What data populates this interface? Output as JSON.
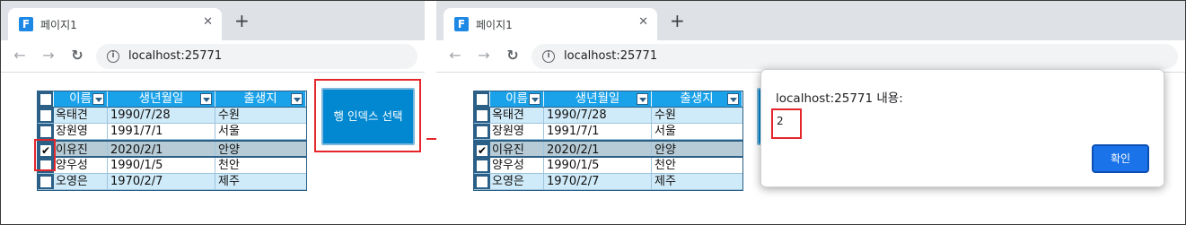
{
  "browser": {
    "tab_title": "페이지1",
    "favicon_letter": "F",
    "tab_close": "✕",
    "new_tab": "+",
    "url": "localhost:25771"
  },
  "grid": {
    "columns": [
      "이름",
      "생년월일",
      "출생지"
    ],
    "rows": [
      {
        "name": "옥태견",
        "birth": "1990/7/28",
        "place": "수원",
        "checked": false
      },
      {
        "name": "장원영",
        "birth": "1991/7/1",
        "place": "서울",
        "checked": false
      },
      {
        "name": "이유진",
        "birth": "2020/2/1",
        "place": "안양",
        "checked": true
      },
      {
        "name": "양우성",
        "birth": "1990/1/5",
        "place": "천안",
        "checked": false
      },
      {
        "name": "오영은",
        "birth": "1970/2/7",
        "place": "제주",
        "checked": false
      }
    ],
    "selected_row_index": 2
  },
  "action_button": {
    "label": "행 인덱스 선택"
  },
  "dialog": {
    "title": "localhost:25771 내용:",
    "message": "2",
    "ok_label": "확인"
  },
  "colors": {
    "accent_red": "#e4262b",
    "grid_header": "#19a2ea",
    "button_blue": "#0288d1",
    "dialog_ok": "#1a73e8"
  }
}
